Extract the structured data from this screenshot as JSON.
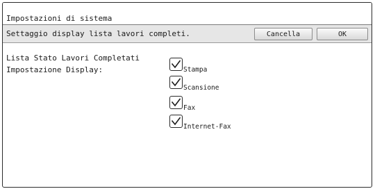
{
  "window": {
    "title": "Impostazioni di sistema"
  },
  "header": {
    "title": "Settaggio display lista lavori completi.",
    "cancel_label": "Cancella",
    "ok_label": "OK"
  },
  "main": {
    "label_line1": "Lista Stato Lavori Completati",
    "label_line2": "Impostazione Display:",
    "options": [
      {
        "label": "Stampa",
        "checked": true
      },
      {
        "label": "Scansione",
        "checked": true
      },
      {
        "label": "Fax",
        "checked": true
      },
      {
        "label": "Internet-Fax",
        "checked": true
      }
    ]
  }
}
